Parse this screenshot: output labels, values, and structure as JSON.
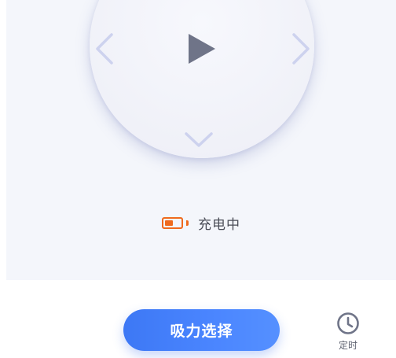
{
  "control_pad": {
    "left_icon": "chevron-left-icon",
    "right_icon": "chevron-right-icon",
    "down_icon": "chevron-down-icon",
    "center_icon": "play-icon"
  },
  "status": {
    "battery_icon": "battery-icon",
    "charge_level": 0.55,
    "text": "充电中",
    "battery_color": "#ef6a1d"
  },
  "actions": {
    "suction_label": "吸力选择",
    "timer_icon": "clock-icon",
    "timer_label": "定时"
  },
  "colors": {
    "accent": "#4b86ff",
    "panel_bg": "#f4f6fb",
    "arrow": "#cdd2ee",
    "play": "#6f7488"
  }
}
